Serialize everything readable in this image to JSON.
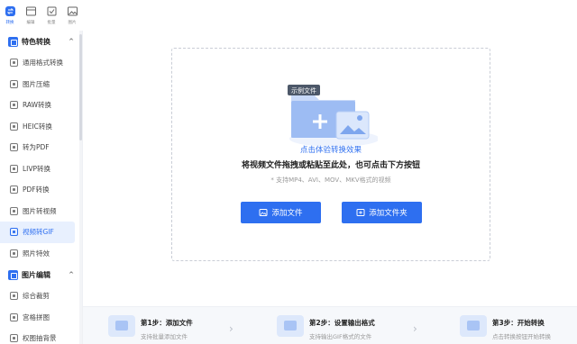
{
  "topbar": {
    "tabs": [
      {
        "label": "转换",
        "icon": "convert-icon",
        "active": true
      },
      {
        "label": "编辑",
        "icon": "edit-icon",
        "active": false
      },
      {
        "label": "批量",
        "icon": "batch-icon",
        "active": false
      },
      {
        "label": "图片",
        "icon": "image-icon",
        "active": false
      }
    ]
  },
  "sidebar": {
    "group1": {
      "title": "特色转换",
      "chevron": "^"
    },
    "items": [
      {
        "label": "通用格式转换"
      },
      {
        "label": "图片压缩"
      },
      {
        "label": "RAW转换"
      },
      {
        "label": "HEIC转换"
      },
      {
        "label": "转为PDF"
      },
      {
        "label": "LIVP转换"
      },
      {
        "label": "PDF转换"
      },
      {
        "label": "图片转视频"
      },
      {
        "label": "视频转GIF"
      },
      {
        "label": "照片特效"
      }
    ],
    "group2": {
      "title": "图片编辑",
      "chevron": "^"
    },
    "items2": [
      {
        "label": "综合裁剪"
      },
      {
        "label": "宫格拼图"
      },
      {
        "label": "权图抽背景"
      }
    ]
  },
  "drop": {
    "example_badge": "示例文件",
    "link": "点击体验转换效果",
    "title": "将视频文件拖拽或粘贴至此处，也可点击下方按钮",
    "hint": "* 支持MP4、AVI、MOV、MKV格式的视频",
    "add_file": "添加文件",
    "add_folder": "添加文件夹"
  },
  "steps": [
    {
      "title": "第1步：添加文件",
      "desc": "支持批量添加文件"
    },
    {
      "title": "第2步：设置输出格式",
      "desc": "支持输出GIF格式的文件"
    },
    {
      "title": "第3步：开始转换",
      "desc": "点击转换按钮开始转换"
    }
  ],
  "colors": {
    "accent": "#2e6ff0",
    "selected_bg": "#e8f0fe"
  }
}
